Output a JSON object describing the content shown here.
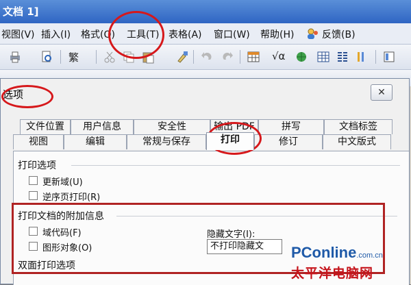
{
  "window": {
    "title": "文档 1]"
  },
  "menu": {
    "items": [
      {
        "label": "视图(V)"
      },
      {
        "label": "插入(I)"
      },
      {
        "label": "格式(O)"
      },
      {
        "label": "工具(T)"
      },
      {
        "label": "表格(A)"
      },
      {
        "label": "窗口(W)"
      },
      {
        "label": "帮助(H)"
      }
    ],
    "feedback_label": "反馈(B)"
  },
  "toolbar": {
    "traditional_label": "繁",
    "formula_label": "√α"
  },
  "dialog": {
    "title": "选项",
    "close_glyph": "✕",
    "tabs_row1": [
      "文件位置",
      "用户信息",
      "安全性",
      "输出 PDF",
      "拼写",
      "文档标签"
    ],
    "tabs_row2": [
      "视图",
      "编辑",
      "常规与保存",
      "打印",
      "修订",
      "中文版式"
    ],
    "active_tab": "打印",
    "print_options": {
      "heading": "打印选项",
      "items": [
        {
          "label": "更新域(U)",
          "checked": false
        },
        {
          "label": "逆序页打印(R)",
          "checked": false
        }
      ]
    },
    "extra_info": {
      "heading": "打印文档的附加信息",
      "items": [
        {
          "label": "域代码(F)",
          "checked": false
        },
        {
          "label": "图形对象(O)",
          "checked": false
        }
      ],
      "hidden_text_label": "隐藏文字(I):",
      "hidden_text_value": "不打印隐藏文"
    },
    "duplex_heading": "双面打印选项"
  },
  "watermark": {
    "brand": "PConline",
    "domain_suffix": ".com.cn",
    "chinese": "太平洋电脑网"
  },
  "colors": {
    "annotation_red": "#d6181b",
    "title_blue": "#2f65c3",
    "brand_blue": "#1f5aa8",
    "brand_red": "#c5141b"
  }
}
